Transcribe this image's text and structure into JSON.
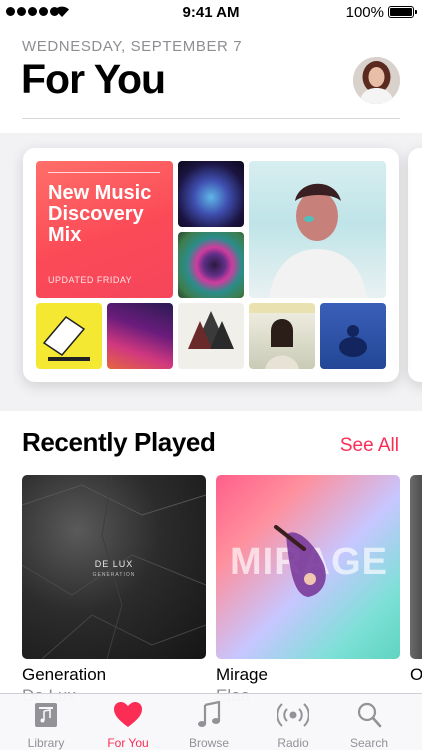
{
  "status_bar": {
    "time": "9:41 AM",
    "battery": "100%"
  },
  "header": {
    "date": "WEDNESDAY, SEPTEMBER 7",
    "title": "For You"
  },
  "mix": {
    "title": "New Music Discovery Mix",
    "subtitle": "UPDATED FRIDAY"
  },
  "recently_played": {
    "title": "Recently Played",
    "see_all": "See All",
    "albums": [
      {
        "name": "Generation",
        "artist": "De Lux",
        "art_text": "DE LUX",
        "art_sub": "GENERATION"
      },
      {
        "name": "Mirage",
        "artist": "Elaa",
        "art_text": "MIRAGE"
      },
      {
        "name": "O",
        "artist": ""
      }
    ]
  },
  "tabs": [
    {
      "label": "Library",
      "icon": "library-icon",
      "active": false
    },
    {
      "label": "For You",
      "icon": "heart-icon",
      "active": true
    },
    {
      "label": "Browse",
      "icon": "music-note-icon",
      "active": false
    },
    {
      "label": "Radio",
      "icon": "radio-icon",
      "active": false
    },
    {
      "label": "Search",
      "icon": "search-icon",
      "active": false
    }
  ],
  "colors": {
    "accent": "#fb2d55",
    "mix_red": "#fb4a57",
    "secondary_text": "#8e8e93"
  }
}
